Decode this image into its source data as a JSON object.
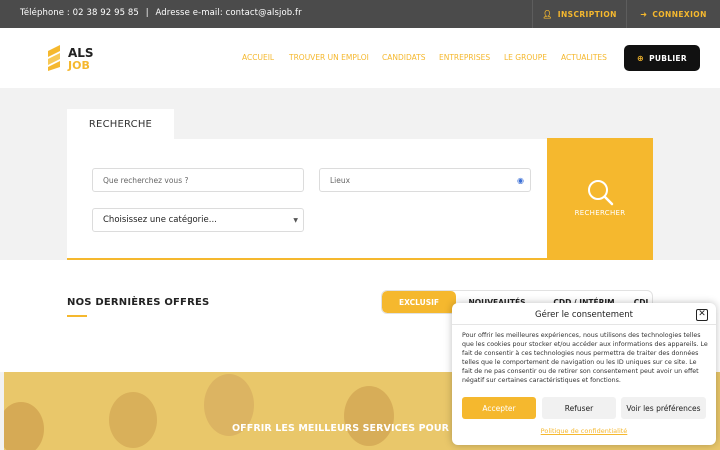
{
  "topbar": {
    "phone": "Téléphone : 02 38 92 95 85",
    "separator": "|",
    "email": "Adresse e-mail: contact@alsjob.fr",
    "signup_label": "INSCRIPTION",
    "login_label": "CONNEXION"
  },
  "header": {
    "logo_line1": "ALS",
    "logo_line2": "JOB",
    "nav": [
      "ACCUEIL",
      "TROUVER UN EMPLOI",
      "CANDIDATS",
      "ENTREPRISES",
      "LE GROUPE",
      "ACTUALITES"
    ],
    "publish_label": "PUBLIER"
  },
  "search": {
    "tab_label": "RECHERCHE",
    "query_placeholder": "Que recherchez vous ?",
    "location_placeholder": "Lieux",
    "category_value": "Choisissez une catégorie...",
    "button_label": "RECHERCHER"
  },
  "offers": {
    "title": "NOS DERNIÈRES OFFRES",
    "tabs": [
      "EXCLUSIF",
      "NOUVEAUTÉS",
      "CDD / INTÉRIM",
      "CDI"
    ]
  },
  "hero": {
    "text": "OFFRIR LES MEILLEURS SERVICES POUR NOS C"
  },
  "consent": {
    "title": "Gérer le consentement",
    "body": "Pour offrir les meilleures expériences, nous utilisons des technologies telles que les cookies pour stocker et/ou accéder aux informations des appareils. Le fait de consentir à ces technologies nous permettra de traiter des données telles que le comportement de navigation ou les ID uniques sur ce site. Le fait de ne pas consentir ou de retirer son consentement peut avoir un effet négatif sur certaines caractéristiques et fonctions.",
    "accept_label": "Accepter",
    "refuse_label": "Refuser",
    "preferences_label": "Voir les préférences",
    "policy_label": "Politique de confidentialité"
  },
  "colors": {
    "accent": "#f5b82e",
    "topbar": "#4b4b4b",
    "dark_button": "#111111"
  },
  "icons": [
    "user-icon",
    "signin-icon",
    "plus-circle-icon",
    "location-target-icon",
    "search-icon",
    "close-icon"
  ]
}
